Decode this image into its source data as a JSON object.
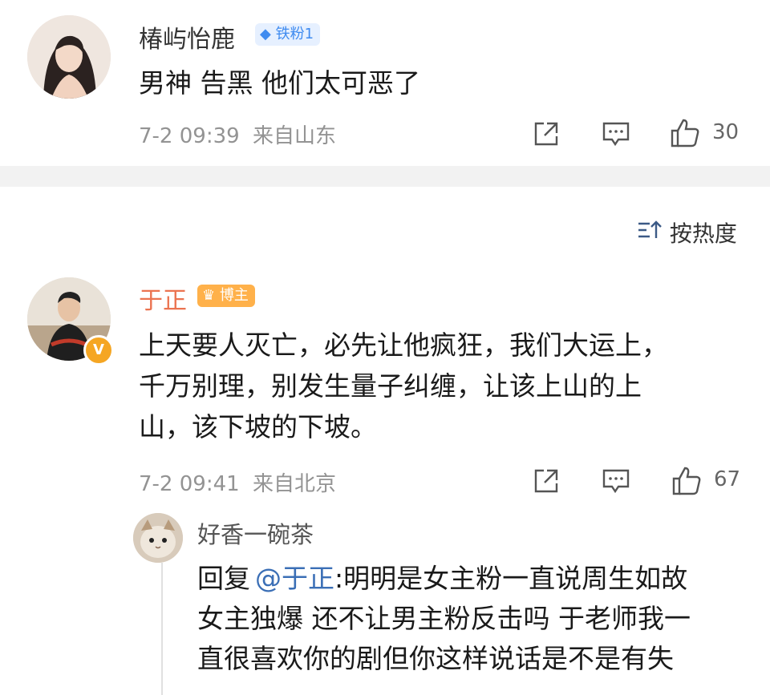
{
  "comments": [
    {
      "user": "椿屿怡鹿",
      "badge": "铁粉1",
      "text": "男神 告黑 他们太可恶了",
      "time": "7-2 09:39",
      "location": "来自山东",
      "likes": "30"
    },
    {
      "user": "于正",
      "badge": "博主",
      "text_lines": [
        "上天要人灭亡，必先让他疯狂，我们大运上，",
        "千万别理，别发生量子纠缠，让该上山的上",
        "山，该下坡的下坡。"
      ],
      "time": "7-2 09:41",
      "location": "来自北京",
      "likes": "67"
    }
  ],
  "sort": {
    "label": "按热度"
  },
  "reply": {
    "user": "好香一碗茶",
    "prefix": "回复",
    "mention": "@于正",
    "colon": ":",
    "line1_rest": "明明是女主粉一直说周生如故",
    "line2": "女主独爆 还不让男主粉反击吗 于老师我一",
    "line3": "直很喜欢你的剧但你这样说话是不是有失"
  },
  "colors": {
    "blogger_name": "#eb7350",
    "fan_badge": "#3f8bf0",
    "mention": "#3b6fb6",
    "verified": "#f5a623"
  }
}
